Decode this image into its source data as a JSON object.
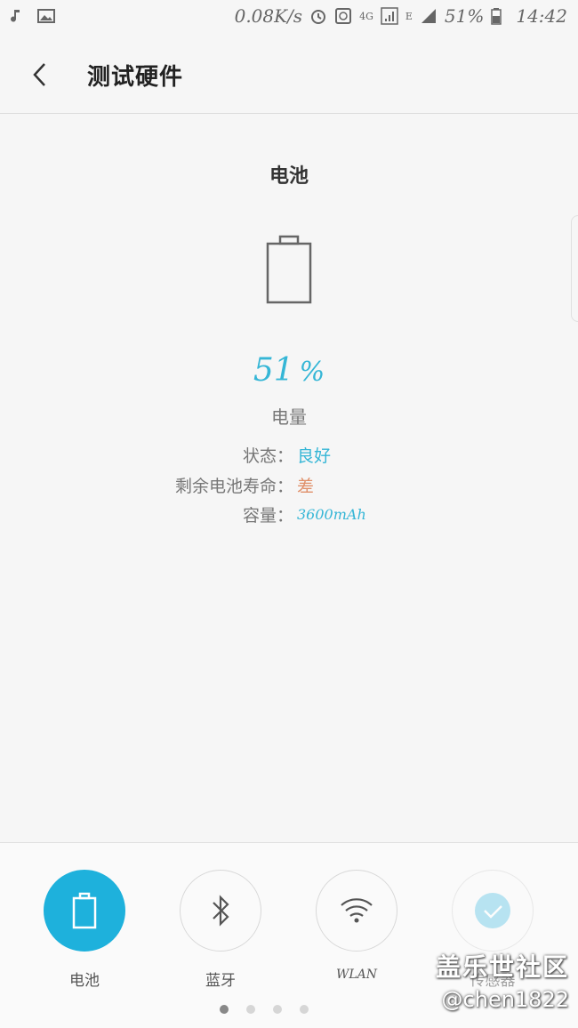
{
  "status_bar": {
    "speed": "0.08K/s",
    "battery": "51%",
    "time": "14:42",
    "network_4g": "4G",
    "network_e": "E"
  },
  "header": {
    "title": "测试硬件"
  },
  "battery_section": {
    "title": "电池",
    "percent_value": "51",
    "percent_unit": "%",
    "percent_label": "电量",
    "rows": [
      {
        "label": "状态",
        "separator": "：",
        "value": "良好"
      },
      {
        "label": "剩余电池寿命",
        "separator": "：",
        "value": "差"
      },
      {
        "label": "容量",
        "separator": "：",
        "value": "3600mAh"
      }
    ]
  },
  "tiles": [
    {
      "label": "电池",
      "icon": "battery-icon",
      "active": true
    },
    {
      "label": "蓝牙",
      "icon": "bluetooth-icon",
      "active": false
    },
    {
      "label": "WLAN",
      "icon": "wifi-icon",
      "active": false
    },
    {
      "label": "传感器",
      "icon": "check-icon",
      "active": false
    }
  ],
  "pager": {
    "count": 4,
    "active": 0
  },
  "watermark": {
    "line1": "盖乐世社区",
    "line2": "@chen1822"
  },
  "colors": {
    "accent": "#1eb1dc",
    "good": "#35b6d6",
    "bad": "#e0906a"
  }
}
